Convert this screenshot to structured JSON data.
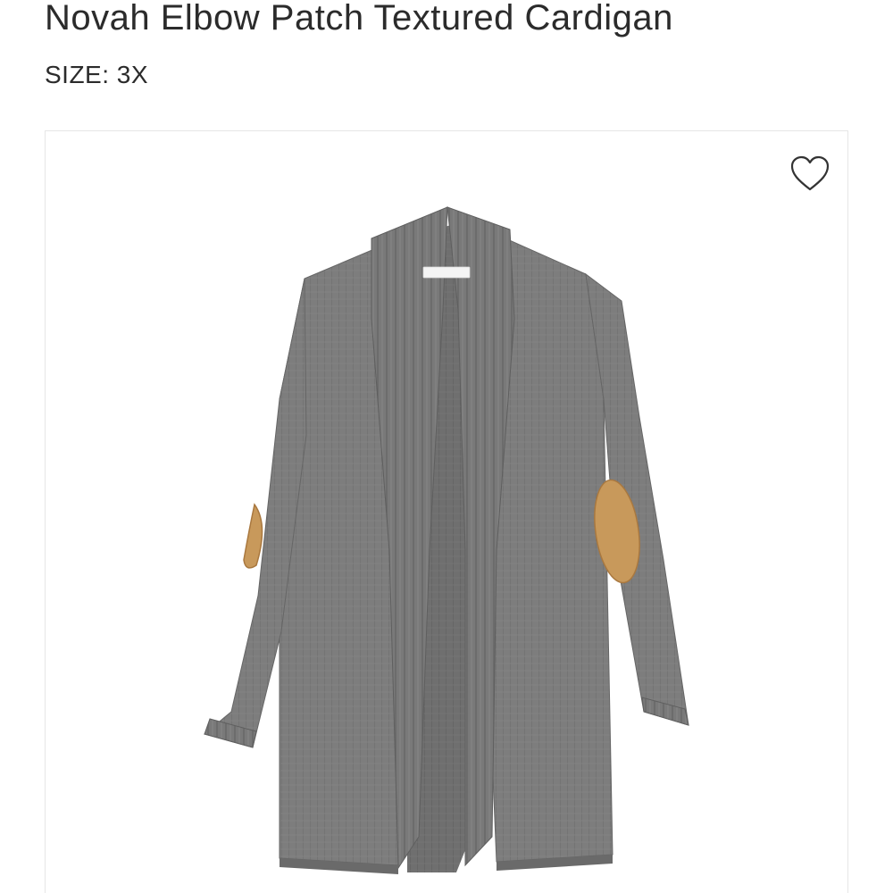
{
  "product": {
    "title": "Novah Elbow Patch Textured Cardigan",
    "size_label": "SIZE: 3X"
  },
  "image": {
    "alt": "Gray waffle-knit open cardigan with tan elbow patches",
    "garment_color": "#7d7d7d",
    "patch_color": "#c8995b"
  },
  "favorite": {
    "icon": "heart-outline-icon",
    "aria_label": "Favorite"
  },
  "colors": {
    "text": "#2b2b2b",
    "card_border": "#e6e6e6",
    "background": "#ffffff"
  }
}
